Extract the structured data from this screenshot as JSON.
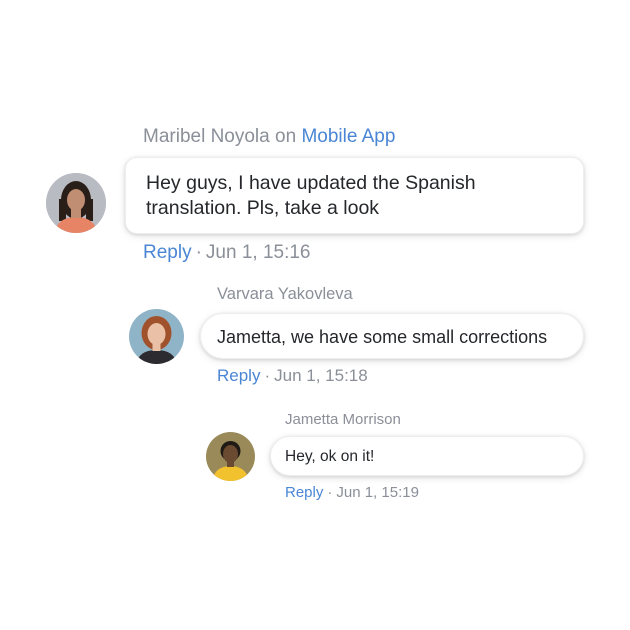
{
  "comments": [
    {
      "author": "Maribel Noyola",
      "connector": "on",
      "source": "Mobile App",
      "avatar_icon": "user-photo-woman-dark-hair",
      "message_line1": "Hey guys, I have updated the Spanish",
      "message_line2": "translation. Pls, take a look",
      "reply_label": "Reply",
      "separator": "·",
      "timestamp": "Jun 1, 15:16"
    },
    {
      "author": "Varvara Yakovleva",
      "avatar_icon": "user-photo-woman-red-hair",
      "message": "Jametta, we have some small corrections",
      "reply_label": "Reply",
      "separator": "·",
      "timestamp": "Jun 1, 15:18"
    },
    {
      "author": "Jametta Morrison",
      "avatar_icon": "user-photo-woman-yellow-top",
      "message": "Hey, ok on it!",
      "reply_label": "Reply",
      "separator": "·",
      "timestamp": "Jun 1, 15:19"
    }
  ],
  "colors": {
    "link": "#4a86d4",
    "muted": "#8a8f98",
    "text": "#25272b",
    "bubble_bg": "#ffffff"
  }
}
